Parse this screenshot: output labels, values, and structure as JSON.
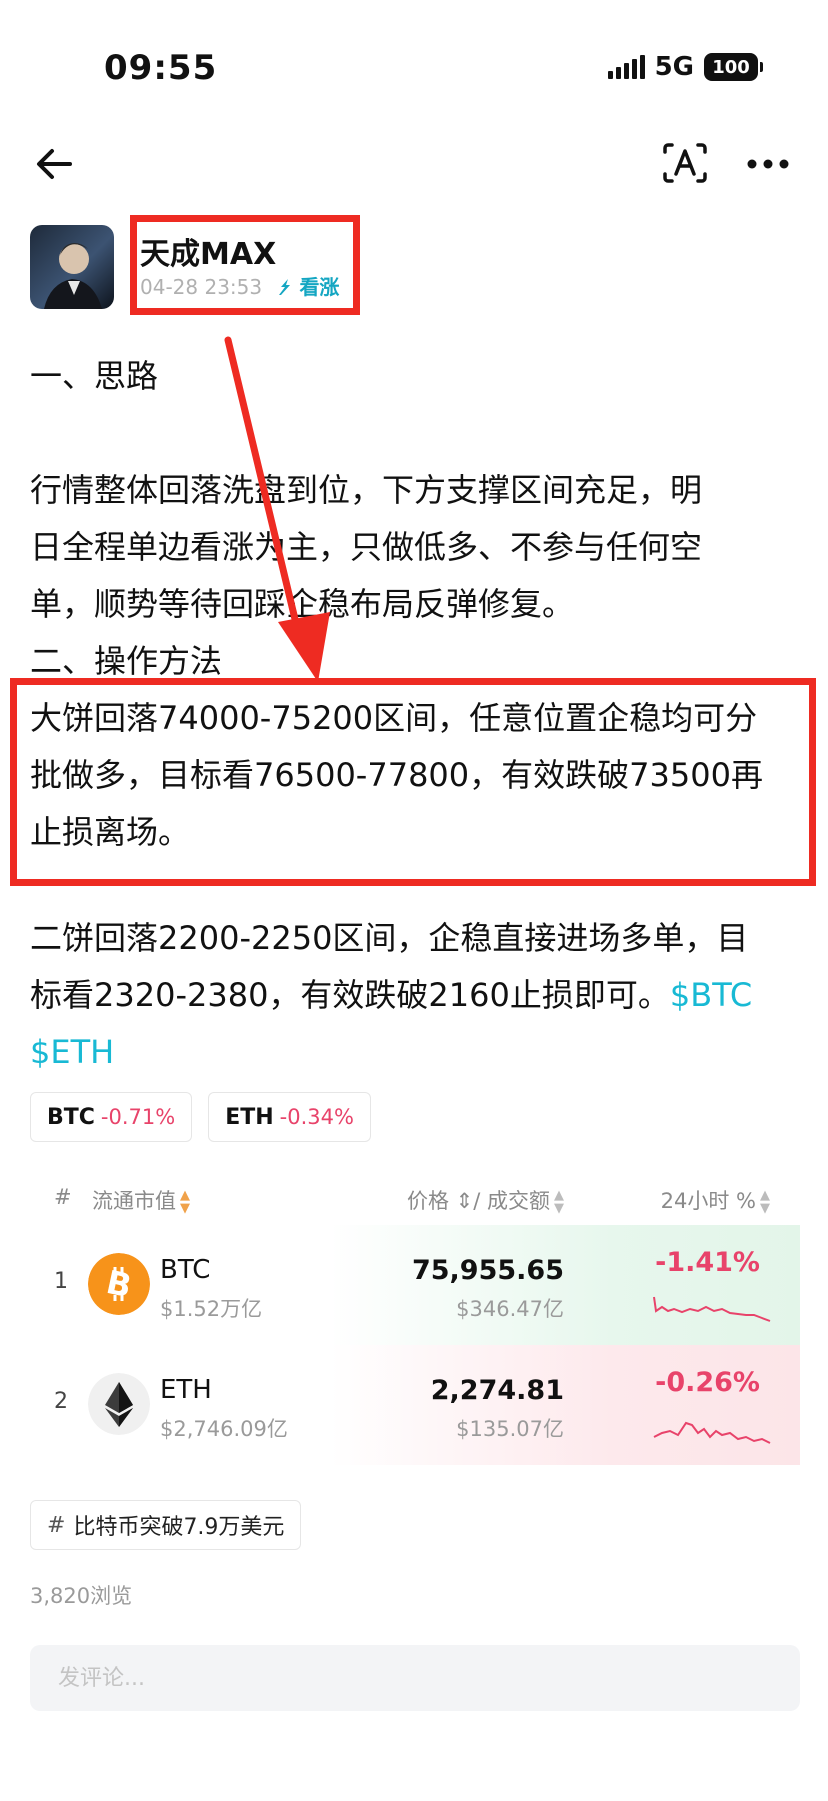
{
  "status_bar": {
    "time": "09:55",
    "network": "5G",
    "battery": "100"
  },
  "nav": {
    "back_icon": "arrow-left-icon",
    "translate_icon": "translate-icon",
    "more_icon": "more-dots-icon"
  },
  "author": {
    "name": "天成MAX",
    "datetime": "04-28 23:53",
    "sentiment": "看涨",
    "sentiment_icon": "arrow-up-icon"
  },
  "post": {
    "section1_title": "一、思路",
    "section1_lines": [
      "行情整体回落洗盘到位，下方支撑区间充足，明",
      "日全程单边看涨为主，只做低多、不参与任何空",
      "单，顺势等待回踩企稳布局反弹修复。"
    ],
    "section2_title": "二、操作方法",
    "btc_lines": [
      "大饼回落74000-75200区间，任意位置企稳均可分",
      "批做多，目标看76500-77800，有效跌破73500再",
      "止损离场。"
    ],
    "eth_line1": "二饼回落2200-2250区间，企稳直接进场多单，目",
    "eth_line2": "标看2320-2380，有效跌破2160止损即可。",
    "tag_btc": "$BTC",
    "tag_eth": "$ETH"
  },
  "coin_chips": [
    {
      "symbol": "BTC",
      "change": "-0.71%"
    },
    {
      "symbol": "ETH",
      "change": "-0.34%"
    }
  ],
  "market": {
    "header": {
      "num": "#",
      "cap": "流通市值",
      "price": "价格 ⇕/ 成交额",
      "change": "24小时 %"
    },
    "rows": [
      {
        "rank": "1",
        "symbol": "BTC",
        "cap": "$1.52万亿",
        "price": "75,955.65",
        "volume": "$346.47亿",
        "change": "-1.41%",
        "trend": "up"
      },
      {
        "rank": "2",
        "symbol": "ETH",
        "cap": "$2,746.09亿",
        "price": "2,274.81",
        "volume": "$135.07亿",
        "change": "-0.26%",
        "trend": "down"
      }
    ]
  },
  "topic": {
    "label": "比特币突破7.9万美元"
  },
  "views": "3,820浏览",
  "comment": {
    "placeholder": "发评论..."
  },
  "colors": {
    "highlight_box": "#ee2b22",
    "link": "#18b9d4",
    "negative": "#e8436a"
  }
}
